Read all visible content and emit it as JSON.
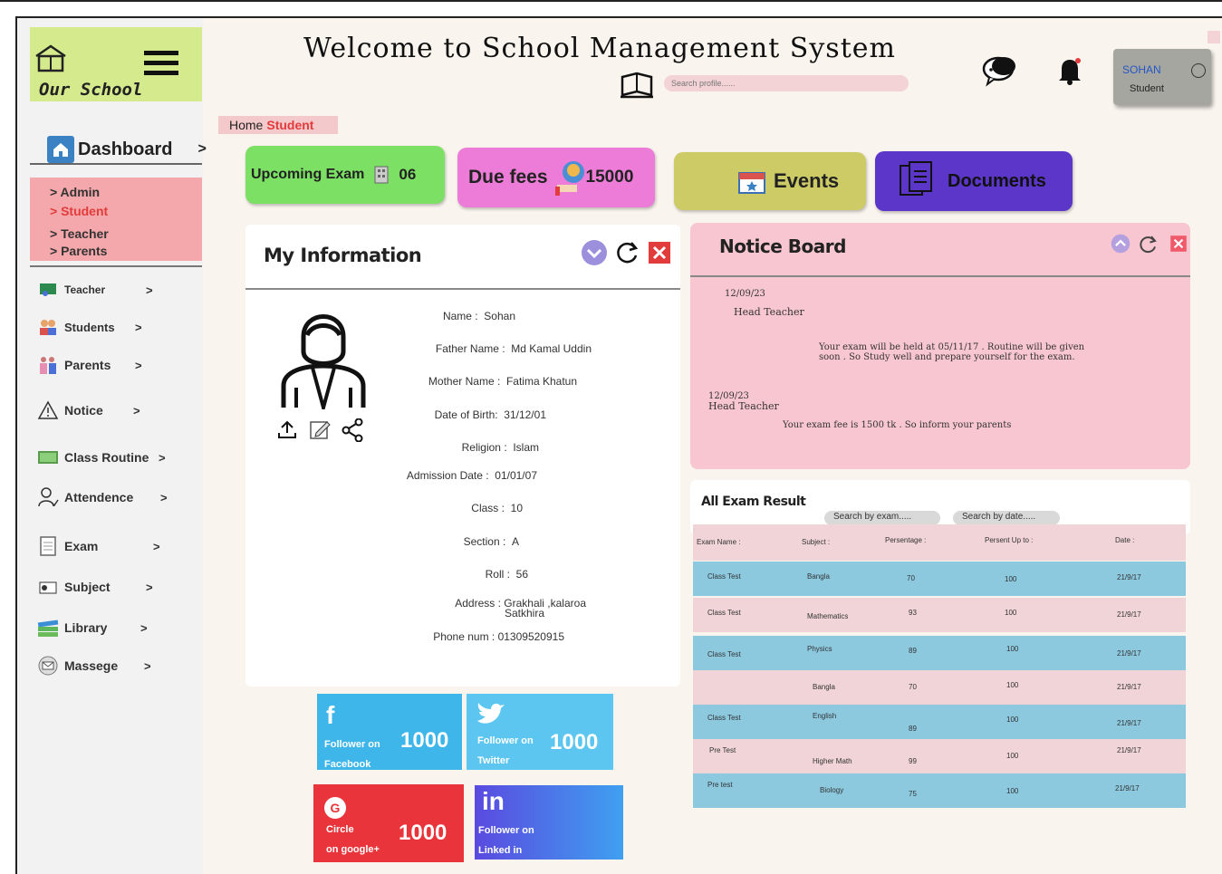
{
  "brand": {
    "name": "Our School"
  },
  "header": {
    "title": "Welcome to School Management System",
    "search_placeholder": "Search profile......",
    "user_name": "SOHAN",
    "user_role": "Student"
  },
  "sidebar": {
    "dashboard": "Dashboard",
    "dashboard_arrow": ">",
    "submenu": [
      "Admin",
      "Student",
      "Teacher",
      "Parents"
    ],
    "submenu_active": "Student",
    "items": [
      {
        "label": "Teacher",
        "icon": "teacher-icon"
      },
      {
        "label": "Students",
        "icon": "students-icon"
      },
      {
        "label": "Parents",
        "icon": "parents-icon"
      },
      {
        "label": "Notice",
        "icon": "warning-icon"
      },
      {
        "label": "Class Routine",
        "icon": "routine-icon"
      },
      {
        "label": "Attendence",
        "icon": "attendance-icon"
      },
      {
        "label": "Exam",
        "icon": "exam-icon"
      },
      {
        "label": "Subject",
        "icon": "subject-icon"
      },
      {
        "label": "Library",
        "icon": "books-icon"
      },
      {
        "label": "Massege",
        "icon": "message-icon"
      }
    ],
    "chevron": ">"
  },
  "breadcrumb": {
    "home": "Home",
    "current": "Student"
  },
  "cards": {
    "exam_label": "Upcoming Exam",
    "exam_count": "06",
    "fees_label": "Due fees",
    "fees_amount": "15000",
    "events_label": "Events",
    "documents_label": "Documents"
  },
  "my_info": {
    "title": "My Information",
    "rows": [
      {
        "label": "Name :",
        "value": "Sohan"
      },
      {
        "label": "Father Name :",
        "value": "Md Kamal Uddin"
      },
      {
        "label": "Mother Name :",
        "value": "Fatima Khatun"
      },
      {
        "label": "Date of Birth:",
        "value": "31/12/01"
      },
      {
        "label": "Religion :",
        "value": "Islam"
      },
      {
        "label": "Admission Date :",
        "value": "01/01/07"
      },
      {
        "label": "Class :",
        "value": "10"
      },
      {
        "label": "Section :",
        "value": "A"
      },
      {
        "label": "Roll :",
        "value": "56"
      },
      {
        "label": "Address :",
        "value": "Grakhali ,kalaroa"
      },
      {
        "label": "Phone num :",
        "value": "01309520915"
      }
    ],
    "address_line2": "Satkhira"
  },
  "social": {
    "facebook": {
      "line1": "Follower on",
      "line2": "Facebook",
      "count": "1000",
      "color": "#3fb6ea"
    },
    "twitter": {
      "line1": "Follower on",
      "line2": "Twitter",
      "count": "1000",
      "color": "#5cc6f0"
    },
    "google": {
      "line1": "Circle",
      "line2": "on google+",
      "count": "1000",
      "color": "#e8343a"
    },
    "linkedin": {
      "line1": "Follower on",
      "line2": "Linked in",
      "count": "",
      "color": "#4a67e8"
    }
  },
  "notice_board": {
    "title": "Notice Board",
    "notices": [
      {
        "date": "12/09/23",
        "from": "Head Teacher",
        "text_line1": "Your exam will be held at 05/11/17 . Routine will be given",
        "text_line2": "soon . So Study well and prepare yourself for the exam."
      },
      {
        "date": "12/09/23",
        "from": "Head Teacher",
        "text_line1": "Your exam fee is 1500 tk . So inform your parents",
        "text_line2": ""
      }
    ]
  },
  "exam_results": {
    "title": "All Exam Result",
    "search_exam": "Search by exam.....",
    "search_date": "Search by date.....",
    "columns": [
      "Exam Name :",
      "Subject :",
      "Persentage :",
      "Persent Up to :",
      "Date :"
    ],
    "rows": [
      [
        "Class Test",
        "Bangla",
        "70",
        "100",
        "21/9/17"
      ],
      [
        "Class Test",
        "Mathematics",
        "93",
        "100",
        "21/9/17"
      ],
      [
        "Class Test",
        "Physics",
        "89",
        "100",
        "21/9/17"
      ],
      [
        "",
        "Bangla",
        "70",
        "100",
        "21/9/17"
      ],
      [
        "Class Test",
        "English",
        "89",
        "100",
        "21/9/17"
      ],
      [
        "Pre Test",
        "Higher Math",
        "99",
        "100",
        "21/9/17"
      ],
      [
        "Pre test",
        "Biology",
        "75",
        "100",
        "21/9/17"
      ]
    ]
  },
  "colors": {
    "accent_green": "#d5ea8c",
    "submenu_pink": "#f4a8ab",
    "active_red": "#e23b3b",
    "row_blue": "#8cc9df",
    "row_pink": "#f0d4d7"
  }
}
